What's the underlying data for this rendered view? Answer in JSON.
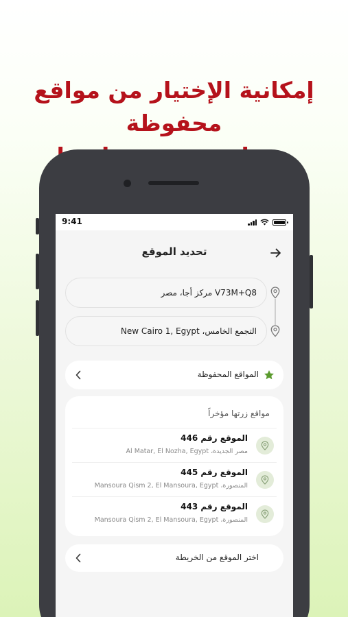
{
  "headline": {
    "line1": "إمكانية الإختيار من مواقع محفوظة",
    "line2": "ومواقع قمت بزيارتها"
  },
  "status_bar": {
    "time": "9:41"
  },
  "header": {
    "title": "تحديد الموقع",
    "back_icon": "arrow-right-icon"
  },
  "route": {
    "from": "V73M+Q8 مركز أجا، مصر",
    "to": "التجمع الخامس، New Cairo 1, Egypt"
  },
  "saved_locations": {
    "label": "المواقع المحفوظة",
    "icon": "star-icon"
  },
  "recent": {
    "title": "مواقع زرتها مؤخراً",
    "items": [
      {
        "name": "الموقع رقم 446",
        "address": "مصر الجديدة، Al Matar, El Nozha, Egypt"
      },
      {
        "name": "الموقع رقم 445",
        "address": "المنصورة، Mansoura Qism 2, El Mansoura, Egypt"
      },
      {
        "name": "الموقع رقم 443",
        "address": "المنصورة، Mansoura Qism 2, El Mansoura, Egypt"
      }
    ]
  },
  "map_pick": {
    "label": "اختر الموقع من الخريطة"
  },
  "colors": {
    "headline": "#b5121b",
    "star": "#5a9a2d",
    "pin_bg": "#e3ecd9",
    "phone": "#3c3d42"
  }
}
